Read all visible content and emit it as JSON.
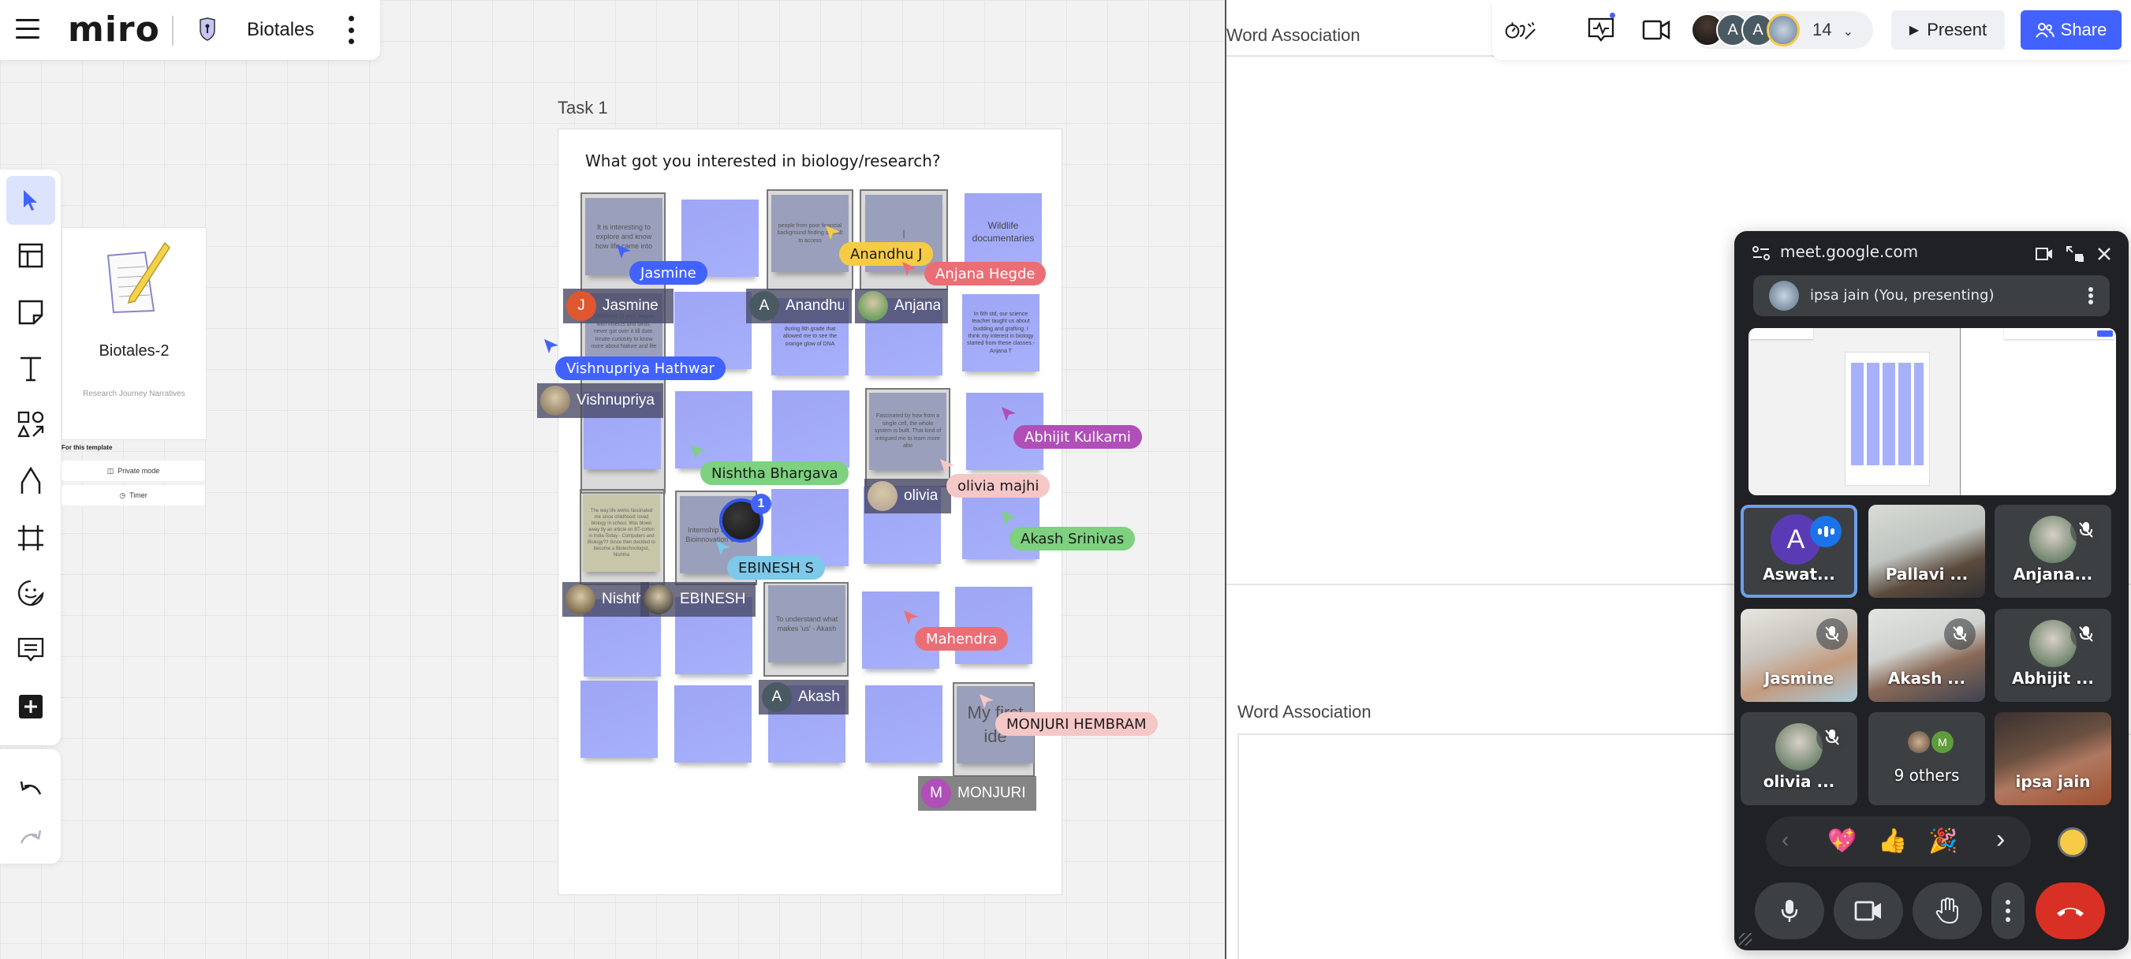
{
  "app": {
    "menu_icon": "hamburger-icon",
    "logo": "miro",
    "board_name": "Biotales",
    "board_icon": "private-board-shield-icon"
  },
  "left_toolbar": {
    "tools": [
      {
        "name": "select",
        "icon": "cursor-arrow-icon",
        "active": true
      },
      {
        "name": "templates",
        "icon": "layout-icon"
      },
      {
        "name": "sticky-note",
        "icon": "sticky-note-icon"
      },
      {
        "name": "text",
        "icon": "text-icon"
      },
      {
        "name": "shapes",
        "icon": "shapes-icon"
      },
      {
        "name": "pen",
        "icon": "pen-icon"
      },
      {
        "name": "frame",
        "icon": "frame-icon"
      },
      {
        "name": "stickers",
        "icon": "sticker-icon"
      },
      {
        "name": "comment",
        "icon": "comment-icon"
      },
      {
        "name": "more-apps",
        "icon": "plus-square-icon"
      }
    ],
    "undo_icon": "undo-icon",
    "redo_icon": "redo-icon"
  },
  "template_card": {
    "title": "Biotales-2",
    "subtitle": "Research Journey Narratives",
    "section_label": "For this template",
    "private_mode_label": "Private mode",
    "timer_label": "Timer"
  },
  "frame": {
    "label": "Task 1",
    "question": "What got you interested in biology/research?"
  },
  "stickies": [
    {
      "text": "It is interesting to explore and know how life came into",
      "style": "grey"
    },
    {
      "text": "",
      "style": "blue"
    },
    {
      "text": "people from poor financial background finding difficult to access",
      "style": "grey"
    },
    {
      "text": "|",
      "style": "grey"
    },
    {
      "text": "Wildlife documentaries",
      "style": "blue"
    },
    {
      "text": "childhood (3 yrs)- began with insects and birds, never got over it till date. Innate curiosity to know more about Nature and life",
      "style": "grey"
    },
    {
      "text": "",
      "style": "blue"
    },
    {
      "text": "during 8th grade that allowed me to see the orange glow of DNA",
      "style": "blue"
    },
    {
      "text": "",
      "style": "blue"
    },
    {
      "text": "In 6th std, our science teacher taught us about budding and grafting. I think my interest in biology started from these classes.- Anjana T",
      "style": "blue"
    },
    {
      "text": "",
      "style": "blue"
    },
    {
      "text": "",
      "style": "blue"
    },
    {
      "text": "",
      "style": "blue"
    },
    {
      "text": "Fascinated by how from a single cell, the whole system is built. That kind of intrigued me to learn more abo",
      "style": "grey"
    },
    {
      "text": "",
      "style": "blue"
    },
    {
      "text": "The way life works fascinated me since childhood; loved biology in school. Was blown away by an article on BT-cotton in India Today - Computers and Biology?!! Since then decided to become a Biotechnologist. Nishtha",
      "style": "olive"
    },
    {
      "text": "Internship Banglore Bioinnovation Centre",
      "style": "grey"
    },
    {
      "text": "",
      "style": "blue"
    },
    {
      "text": "",
      "style": "blue"
    },
    {
      "text": "",
      "style": "blue"
    },
    {
      "text": "",
      "style": "blue"
    },
    {
      "text": "",
      "style": "blue"
    },
    {
      "text": "To understand what makes 'us' - Akash",
      "style": "grey"
    },
    {
      "text": "",
      "style": "blue"
    },
    {
      "text": "",
      "style": "blue"
    },
    {
      "text": "",
      "style": "blue"
    },
    {
      "text": "",
      "style": "blue"
    },
    {
      "text": "",
      "style": "blue"
    },
    {
      "text": "",
      "style": "blue"
    },
    {
      "text": "My first ide",
      "style": "grey"
    }
  ],
  "editor_tags": [
    {
      "name": "Jasmine",
      "avatar_letter": "J",
      "avatar_color": "#e0562f"
    },
    {
      "name": "Anandhu",
      "avatar_letter": "A",
      "avatar_color": "#4a5a63"
    },
    {
      "name": "Anjana",
      "avatar_letter": "",
      "avatar_color": "#3f8f3f"
    },
    {
      "name": "Vishnupriya",
      "avatar_letter": "",
      "avatar_color": "#7a6a50"
    },
    {
      "name": "olivia",
      "avatar_letter": "",
      "avatar_color": "#b0a090"
    },
    {
      "name": "Nishtha",
      "avatar_letter": "",
      "avatar_color": "#5a4a2a"
    },
    {
      "name": "EBINESH",
      "avatar_letter": "",
      "avatar_color": "#222222"
    },
    {
      "name": "Akash",
      "avatar_letter": "A",
      "avatar_color": "#4a5a63"
    },
    {
      "name": "MONJURI",
      "avatar_letter": "M",
      "avatar_color": "#b04fb8"
    }
  ],
  "cursors": [
    {
      "name": "Jasmine",
      "color": "#4262ff",
      "text_color": "#ffffff"
    },
    {
      "name": "Anandhu J",
      "color": "#f7cb45",
      "text_color": "#1a1a1a"
    },
    {
      "name": "Anjana Hegde",
      "color": "#eb6e74",
      "text_color": "#ffffff"
    },
    {
      "name": "Vishnupriya Hathwar",
      "color": "#4262ff",
      "text_color": "#ffffff"
    },
    {
      "name": "Abhijit Kulkarni",
      "color": "#b04fb8",
      "text_color": "#ffffff"
    },
    {
      "name": "Nishtha Bhargava",
      "color": "#7dd17f",
      "text_color": "#1a1a1a"
    },
    {
      "name": "olivia majhi",
      "color": "#f6c7c7",
      "text_color": "#1a1a1a"
    },
    {
      "name": "Akash Srinivas",
      "color": "#7dd17f",
      "text_color": "#1a1a1a"
    },
    {
      "name": "EBINESH S",
      "color": "#7ec8ea",
      "text_color": "#1a1a1a"
    },
    {
      "name": "Mahendra",
      "color": "#eb6e74",
      "text_color": "#ffffff"
    },
    {
      "name": "MONJURI HEMBRAM",
      "color": "#f6c7c7",
      "text_color": "#1a1a1a"
    }
  ],
  "comment_badge": {
    "count": "1"
  },
  "word_association": {
    "top_title": "Word Association",
    "bottom_title": "Word Association"
  },
  "top_right": {
    "timer_icon": "timer-reactions-icon",
    "activity_icon": "activity-chart-icon",
    "video_icon": "video-camera-icon",
    "collaborator_count": "14",
    "present_label": "Present",
    "share_label": "Share",
    "accent_color": "#4262ff"
  },
  "meet": {
    "url": "meet.google.com",
    "presenting_label": "ipsa jain (You, presenting)",
    "participants": [
      {
        "name": "Aswat...",
        "type": "letter",
        "letter": "A",
        "speaking": true,
        "muted": false
      },
      {
        "name": "Pallavi ...",
        "type": "video",
        "muted": false
      },
      {
        "name": "Anjana...",
        "type": "avatar",
        "muted": true
      },
      {
        "name": "Jasmine",
        "type": "video",
        "muted": true
      },
      {
        "name": "Akash ...",
        "type": "video",
        "muted": true
      },
      {
        "name": "Abhijit ...",
        "type": "avatar",
        "muted": true
      },
      {
        "name": "olivia ...",
        "type": "avatar",
        "muted": true
      },
      {
        "name": "9 others",
        "type": "others",
        "muted": false
      },
      {
        "name": "ipsa jain",
        "type": "video",
        "muted": false
      }
    ],
    "others_avatar_letter": "M",
    "reactions": [
      "💖",
      "👍",
      "🎉"
    ],
    "controls": [
      "mic-icon",
      "camera-icon",
      "raise-hand-icon",
      "more-options-icon",
      "end-call-icon"
    ]
  }
}
